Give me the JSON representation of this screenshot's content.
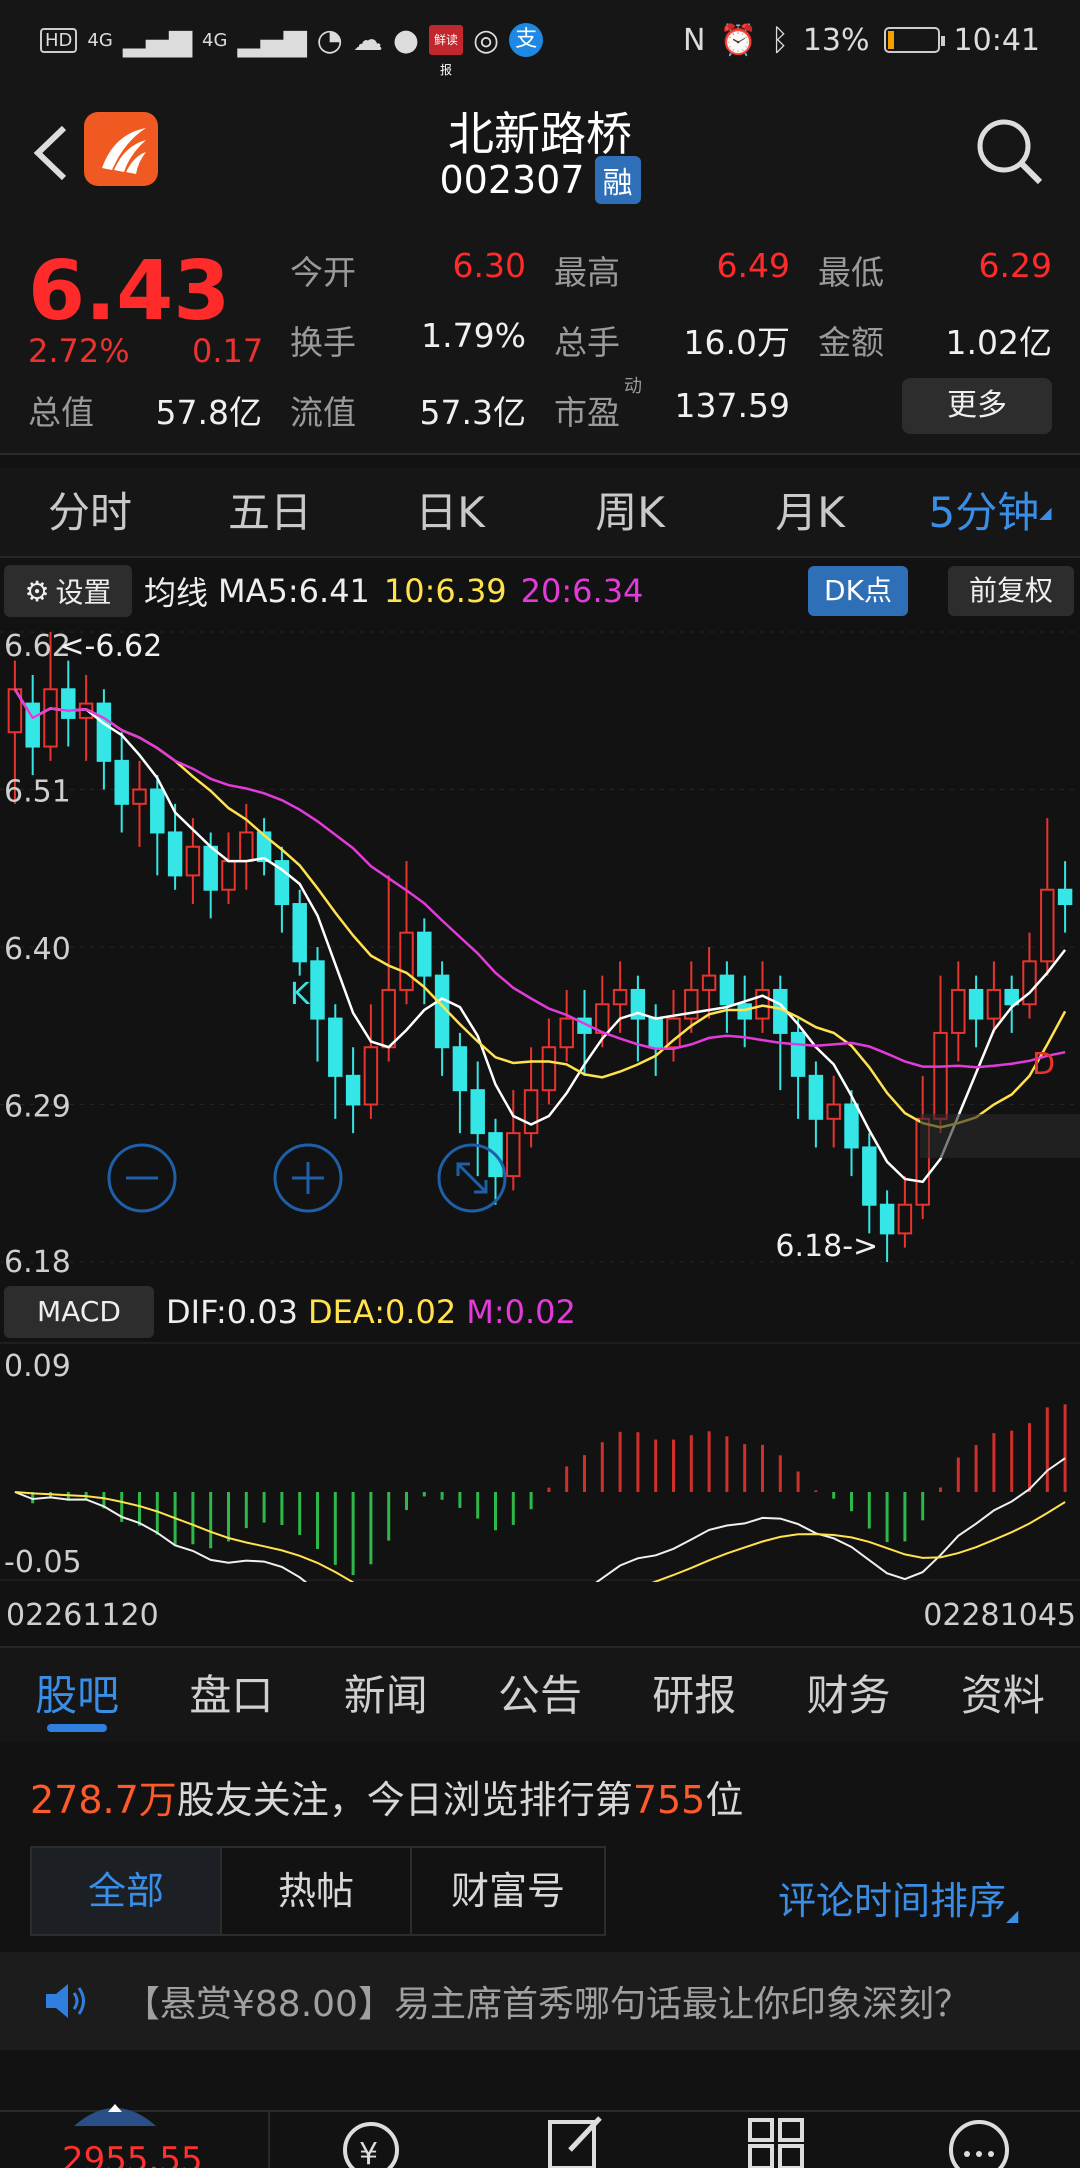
{
  "status_bar": {
    "hd": "HD",
    "sig1": "4G",
    "sig2": "4G",
    "app_badge": "鲜读报",
    "zhi": "支",
    "battery": "13%",
    "time": "10:41",
    "battery_level": 0.13
  },
  "header": {
    "name": "北新路桥",
    "code": "002307",
    "badge": "融"
  },
  "quote": {
    "price": "6.43",
    "pct": "2.72%",
    "change": "0.17",
    "labels": {
      "open": "今开",
      "high": "最高",
      "low": "最低",
      "turnover_rate": "换手",
      "volume": "总手",
      "amount": "金额",
      "total_value": "总值",
      "float_value": "流值",
      "pe": "市盈",
      "pe_sup": "动"
    },
    "values": {
      "open": "6.30",
      "high": "6.49",
      "low": "6.29",
      "turnover_rate": "1.79%",
      "volume": "16.0万",
      "amount": "1.02亿",
      "total_value": "57.8亿",
      "float_value": "57.3亿",
      "pe": "137.59"
    },
    "more": "更多"
  },
  "period_tabs": [
    "分时",
    "五日",
    "日K",
    "周K",
    "月K",
    "5分钟"
  ],
  "ma_bar": {
    "settings": "设置",
    "label": "均线",
    "ma5": "MA5:6.41",
    "ma10": "10:6.39",
    "ma20": "20:6.34",
    "dk": "DK点",
    "adjust": "前复权"
  },
  "kline": {
    "y_labels": [
      "6.62",
      "6.51",
      "6.40",
      "6.29",
      "6.18"
    ],
    "high_marker": "<-6.62",
    "low_marker": "6.18->",
    "k_marker": "K",
    "d_marker": "D"
  },
  "macd_bar": {
    "label": "MACD",
    "dif": "DIF:0.03",
    "dea": "DEA:0.02",
    "m": "M:0.02"
  },
  "macd": {
    "top": "0.09",
    "bottom": "-0.05"
  },
  "dates": {
    "start": "02261120",
    "end": "02281045"
  },
  "info_tabs": [
    "股吧",
    "盘口",
    "新闻",
    "公告",
    "研报",
    "财务",
    "资料"
  ],
  "follow": {
    "count": "278.7万",
    "text1": "股友关注，今日浏览排行第",
    "rank": "755",
    "text2": "位"
  },
  "filters": {
    "all": "全部",
    "hot": "热帖",
    "wealth": "财富号",
    "sort": "评论时间排序"
  },
  "notice": {
    "text": "【悬赏¥88.00】易主席首秀哪句话最让你印象深刻？"
  },
  "bottom_nav": {
    "index_value": "2955.55"
  },
  "chart_data": {
    "type": "candlestick",
    "ylim": [
      6.18,
      6.62
    ],
    "y_labels": [
      "6.62",
      "6.51",
      "6.40",
      "6.29",
      "6.18"
    ],
    "ma": {
      "MA5": 6.41,
      "MA10": 6.39,
      "MA20": 6.34
    },
    "high": 6.62,
    "low": 6.18,
    "candles": [
      [
        6.55,
        6.58,
        6.5,
        6.6
      ],
      [
        6.57,
        6.54,
        6.52,
        6.59
      ],
      [
        6.54,
        6.58,
        6.53,
        6.62
      ],
      [
        6.58,
        6.56,
        6.54,
        6.6
      ],
      [
        6.56,
        6.57,
        6.53,
        6.59
      ],
      [
        6.57,
        6.53,
        6.51,
        6.58
      ],
      [
        6.53,
        6.5,
        6.48,
        6.55
      ],
      [
        6.5,
        6.51,
        6.47,
        6.53
      ],
      [
        6.51,
        6.48,
        6.45,
        6.52
      ],
      [
        6.48,
        6.45,
        6.44,
        6.5
      ],
      [
        6.45,
        6.47,
        6.43,
        6.49
      ],
      [
        6.47,
        6.44,
        6.42,
        6.48
      ],
      [
        6.44,
        6.46,
        6.43,
        6.48
      ],
      [
        6.46,
        6.48,
        6.44,
        6.5
      ],
      [
        6.48,
        6.46,
        6.45,
        6.49
      ],
      [
        6.46,
        6.43,
        6.41,
        6.47
      ],
      [
        6.43,
        6.39,
        6.38,
        6.44
      ],
      [
        6.39,
        6.35,
        6.32,
        6.4
      ],
      [
        6.35,
        6.31,
        6.28,
        6.36
      ],
      [
        6.31,
        6.29,
        6.27,
        6.33
      ],
      [
        6.29,
        6.33,
        6.28,
        6.36
      ],
      [
        6.33,
        6.37,
        6.32,
        6.45
      ],
      [
        6.37,
        6.41,
        6.36,
        6.46
      ],
      [
        6.41,
        6.38,
        6.36,
        6.42
      ],
      [
        6.38,
        6.33,
        6.31,
        6.39
      ],
      [
        6.33,
        6.3,
        6.27,
        6.34
      ],
      [
        6.3,
        6.27,
        6.24,
        6.32
      ],
      [
        6.27,
        6.24,
        6.22,
        6.28
      ],
      [
        6.24,
        6.27,
        6.23,
        6.3
      ],
      [
        6.27,
        6.3,
        6.26,
        6.33
      ],
      [
        6.3,
        6.33,
        6.29,
        6.35
      ],
      [
        6.33,
        6.35,
        6.32,
        6.37
      ],
      [
        6.35,
        6.34,
        6.31,
        6.37
      ],
      [
        6.34,
        6.36,
        6.33,
        6.38
      ],
      [
        6.36,
        6.37,
        6.34,
        6.39
      ],
      [
        6.37,
        6.35,
        6.32,
        6.38
      ],
      [
        6.35,
        6.33,
        6.31,
        6.36
      ],
      [
        6.33,
        6.35,
        6.32,
        6.37
      ],
      [
        6.35,
        6.37,
        6.34,
        6.39
      ],
      [
        6.37,
        6.38,
        6.35,
        6.4
      ],
      [
        6.38,
        6.36,
        6.34,
        6.39
      ],
      [
        6.36,
        6.35,
        6.33,
        6.38
      ],
      [
        6.35,
        6.37,
        6.34,
        6.39
      ],
      [
        6.37,
        6.34,
        6.3,
        6.38
      ],
      [
        6.34,
        6.31,
        6.28,
        6.35
      ],
      [
        6.31,
        6.28,
        6.26,
        6.32
      ],
      [
        6.28,
        6.29,
        6.26,
        6.31
      ],
      [
        6.29,
        6.26,
        6.24,
        6.3
      ],
      [
        6.26,
        6.22,
        6.2,
        6.27
      ],
      [
        6.22,
        6.2,
        6.18,
        6.23
      ],
      [
        6.2,
        6.22,
        6.19,
        6.24
      ],
      [
        6.22,
        6.28,
        6.21,
        6.31
      ],
      [
        6.28,
        6.34,
        6.27,
        6.38
      ],
      [
        6.34,
        6.37,
        6.32,
        6.39
      ],
      [
        6.37,
        6.35,
        6.33,
        6.38
      ],
      [
        6.35,
        6.37,
        6.34,
        6.39
      ],
      [
        6.37,
        6.36,
        6.34,
        6.38
      ],
      [
        6.36,
        6.39,
        6.35,
        6.41
      ],
      [
        6.39,
        6.44,
        6.38,
        6.49
      ],
      [
        6.44,
        6.43,
        6.41,
        6.46
      ]
    ]
  }
}
